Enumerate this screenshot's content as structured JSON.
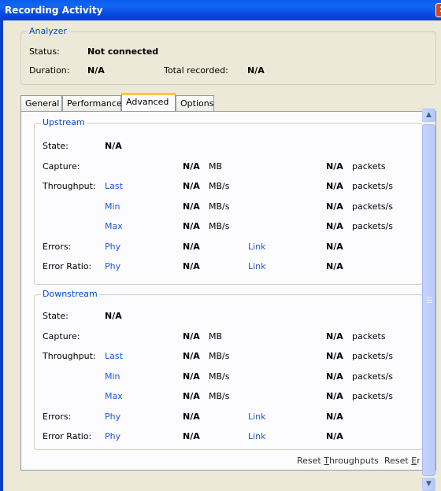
{
  "window": {
    "title": "Recording Activity",
    "close_glyph": "✕"
  },
  "analyzer": {
    "legend": "Analyzer",
    "status_label": "Status:",
    "status_value": "Not connected",
    "duration_label": "Duration:",
    "duration_value": "N/A",
    "total_label": "Total recorded:",
    "total_value": "N/A"
  },
  "tabs": [
    {
      "label": "General"
    },
    {
      "label": "Performance"
    },
    {
      "label": "Advanced"
    },
    {
      "label": "Options"
    }
  ],
  "upstream": {
    "legend": "Upstream",
    "state_label": "State:",
    "state_value": "N/A",
    "capture_label": "Capture:",
    "capture_value": "N/A",
    "capture_unit": "MB",
    "capture_packets": "N/A",
    "capture_packets_unit": "packets",
    "throughput_label": "Throughput:",
    "last_label": "Last",
    "last_value": "N/A",
    "last_unit": "MB/s",
    "last_packets": "N/A",
    "last_packets_unit": "packets/s",
    "min_label": "Min",
    "min_value": "N/A",
    "min_unit": "MB/s",
    "min_packets": "N/A",
    "min_packets_unit": "packets/s",
    "max_label": "Max",
    "max_value": "N/A",
    "max_unit": "MB/s",
    "max_packets": "N/A",
    "max_packets_unit": "packets/s",
    "errors_label": "Errors:",
    "errors_phy": "Phy",
    "errors_phy_value": "N/A",
    "errors_link": "Link",
    "errors_link_value": "N/A",
    "ratio_label": "Error Ratio:",
    "ratio_phy": "Phy",
    "ratio_phy_value": "N/A",
    "ratio_link": "Link",
    "ratio_link_value": "N/A"
  },
  "downstream": {
    "legend": "Downstream",
    "state_label": "State:",
    "state_value": "N/A",
    "capture_label": "Capture:",
    "capture_value": "N/A",
    "capture_unit": "MB",
    "capture_packets": "N/A",
    "capture_packets_unit": "packets",
    "throughput_label": "Throughput:",
    "last_label": "Last",
    "last_value": "N/A",
    "last_unit": "MB/s",
    "last_packets": "N/A",
    "last_packets_unit": "packets/s",
    "min_label": "Min",
    "min_value": "N/A",
    "min_unit": "MB/s",
    "min_packets": "N/A",
    "min_packets_unit": "packets/s",
    "max_label": "Max",
    "max_value": "N/A",
    "max_unit": "MB/s",
    "max_packets": "N/A",
    "max_packets_unit": "packets/s",
    "errors_label": "Errors:",
    "errors_phy": "Phy",
    "errors_phy_value": "N/A",
    "errors_link": "Link",
    "errors_link_value": "N/A",
    "ratio_label": "Error Ratio:",
    "ratio_phy": "Phy",
    "ratio_phy_value": "N/A",
    "ratio_link": "Link",
    "ratio_link_value": "N/A"
  },
  "actions": {
    "reset_throughputs_prefix": "Reset ",
    "reset_throughputs_accel": "T",
    "reset_throughputs_rest": "hroughputs",
    "reset_errors_prefix": "Reset ",
    "reset_errors_accel": "E",
    "reset_errors_rest": "r"
  },
  "scrollbar": {
    "up_glyph": "▲",
    "down_glyph": "▼"
  }
}
